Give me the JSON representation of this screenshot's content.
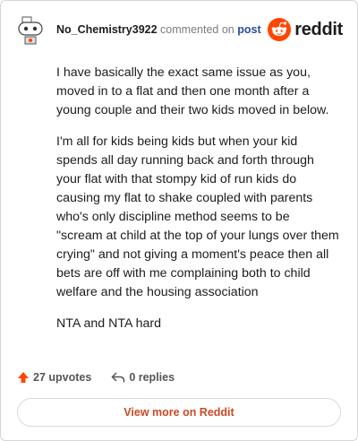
{
  "comment": {
    "username": "No_Chemistry3922",
    "action_text": "commented on",
    "post_link": "post",
    "logo_text": "reddit",
    "paragraphs": [
      "I have basically the exact same issue as you, moved in to a flat and then one month after a young couple and their two kids moved in below.",
      "I'm all for kids being kids but when your kid spends all day running back and forth through your flat with that stompy kid of run kids do causing my flat to shake coupled with parents who's only discipline method seems to be \"scream at child at the top of your lungs over them crying\" and not giving a moment's peace then all bets are off with me complaining both to child welfare and the housing association",
      "NTA and NTA hard"
    ],
    "upvotes": "27 upvotes",
    "replies": "0 replies",
    "view_more": "View more on Reddit"
  },
  "colors": {
    "brand": "#ff4500",
    "link": "#2a4d9b",
    "view_more": "#c94a22"
  }
}
